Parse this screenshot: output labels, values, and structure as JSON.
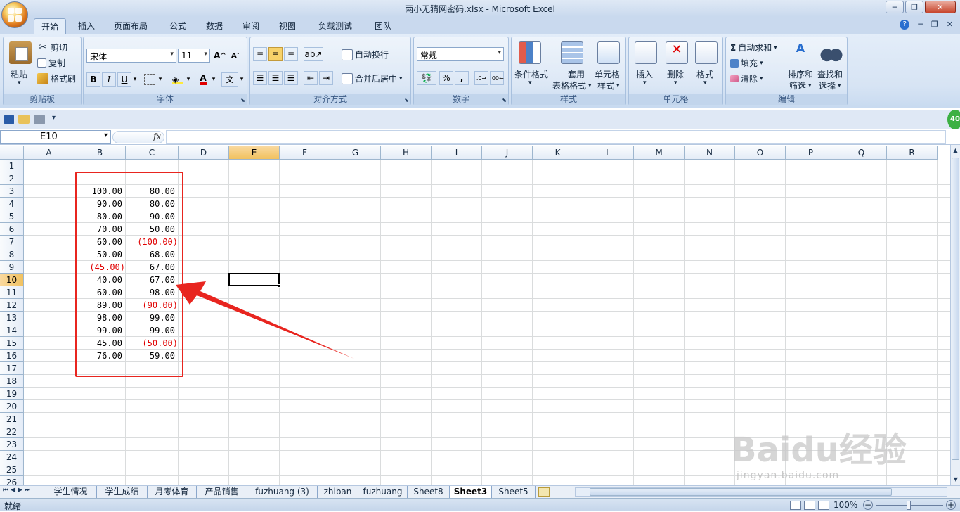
{
  "window": {
    "title": "两小无猜网密码.xlsx - Microsoft Excel"
  },
  "tabs": [
    "开始",
    "插入",
    "页面布局",
    "公式",
    "数据",
    "审阅",
    "视图",
    "负载测试",
    "团队"
  ],
  "ribbon": {
    "clipboard": {
      "paste": "粘贴",
      "cut": "剪切",
      "copy": "复制",
      "format_painter": "格式刷",
      "label": "剪贴板"
    },
    "font": {
      "name": "宋体",
      "size": "11",
      "label": "字体",
      "bold": "B",
      "italic": "I",
      "underline": "U",
      "grow": "A",
      "shrink": "A"
    },
    "alignment": {
      "wrap": "自动换行",
      "merge": "合并后居中",
      "label": "对齐方式"
    },
    "number": {
      "format": "常规",
      "percent": "%",
      "comma": ",",
      "label": "数字"
    },
    "styles": {
      "conditional": "条件格式",
      "table_l1": "套用",
      "table_l2": "表格格式",
      "cell_l1": "单元格",
      "cell_l2": "样式",
      "label": "样式"
    },
    "cells": {
      "insert": "插入",
      "delete": "删除",
      "format": "格式",
      "label": "单元格"
    },
    "editing": {
      "autosum": "自动求和",
      "fill": "填充",
      "clear": "清除",
      "sort_l1": "排序和",
      "sort_l2": "筛选",
      "find_l1": "查找和",
      "find_l2": "选择",
      "label": "编辑"
    }
  },
  "formula": {
    "namebox": "E10",
    "fx": "fx"
  },
  "columns": [
    "A",
    "B",
    "C",
    "D",
    "E",
    "F",
    "G",
    "H",
    "I",
    "J",
    "K",
    "L",
    "M",
    "N",
    "O",
    "P",
    "Q",
    "R"
  ],
  "rows": [
    "1",
    "2",
    "3",
    "4",
    "5",
    "6",
    "7",
    "8",
    "9",
    "10",
    "11",
    "12",
    "13",
    "14",
    "15",
    "16",
    "17",
    "18",
    "19",
    "20",
    "21",
    "22",
    "23",
    "24",
    "25",
    "26"
  ],
  "selected": {
    "column": "E",
    "row": "10"
  },
  "cells": [
    {
      "row": 3,
      "b": "100.00",
      "b_neg": false,
      "c": "80.00",
      "c_neg": false
    },
    {
      "row": 4,
      "b": "90.00",
      "b_neg": false,
      "c": "80.00",
      "c_neg": false
    },
    {
      "row": 5,
      "b": "80.00",
      "b_neg": false,
      "c": "90.00",
      "c_neg": false
    },
    {
      "row": 6,
      "b": "70.00",
      "b_neg": false,
      "c": "50.00",
      "c_neg": false
    },
    {
      "row": 7,
      "b": "60.00",
      "b_neg": false,
      "c": "(100.00)",
      "c_neg": true
    },
    {
      "row": 8,
      "b": "50.00",
      "b_neg": false,
      "c": "68.00",
      "c_neg": false
    },
    {
      "row": 9,
      "b": "(45.00)",
      "b_neg": true,
      "c": "67.00",
      "c_neg": false
    },
    {
      "row": 10,
      "b": "40.00",
      "b_neg": false,
      "c": "67.00",
      "c_neg": false
    },
    {
      "row": 11,
      "b": "60.00",
      "b_neg": false,
      "c": "98.00",
      "c_neg": false
    },
    {
      "row": 12,
      "b": "89.00",
      "b_neg": false,
      "c": "(90.00)",
      "c_neg": true
    },
    {
      "row": 13,
      "b": "98.00",
      "b_neg": false,
      "c": "99.00",
      "c_neg": false
    },
    {
      "row": 14,
      "b": "99.00",
      "b_neg": false,
      "c": "99.00",
      "c_neg": false
    },
    {
      "row": 15,
      "b": "45.00",
      "b_neg": false,
      "c": "(50.00)",
      "c_neg": true
    },
    {
      "row": 16,
      "b": "76.00",
      "b_neg": false,
      "c": "59.00",
      "c_neg": false
    }
  ],
  "annotation": {
    "color": "#e8251f"
  },
  "sheets": [
    "学生情况",
    "学生成绩",
    "月考体育",
    "产品销售",
    "fuzhuang (3)",
    "zhiban",
    "fuzhuang",
    "Sheet8",
    "Sheet3",
    "Sheet5"
  ],
  "active_sheet": "Sheet3",
  "status": {
    "ready": "就绪",
    "zoom": "100%"
  },
  "badge": "40",
  "watermark": {
    "brand": "Baidu经验",
    "url": "jingyan.baidu.com"
  }
}
